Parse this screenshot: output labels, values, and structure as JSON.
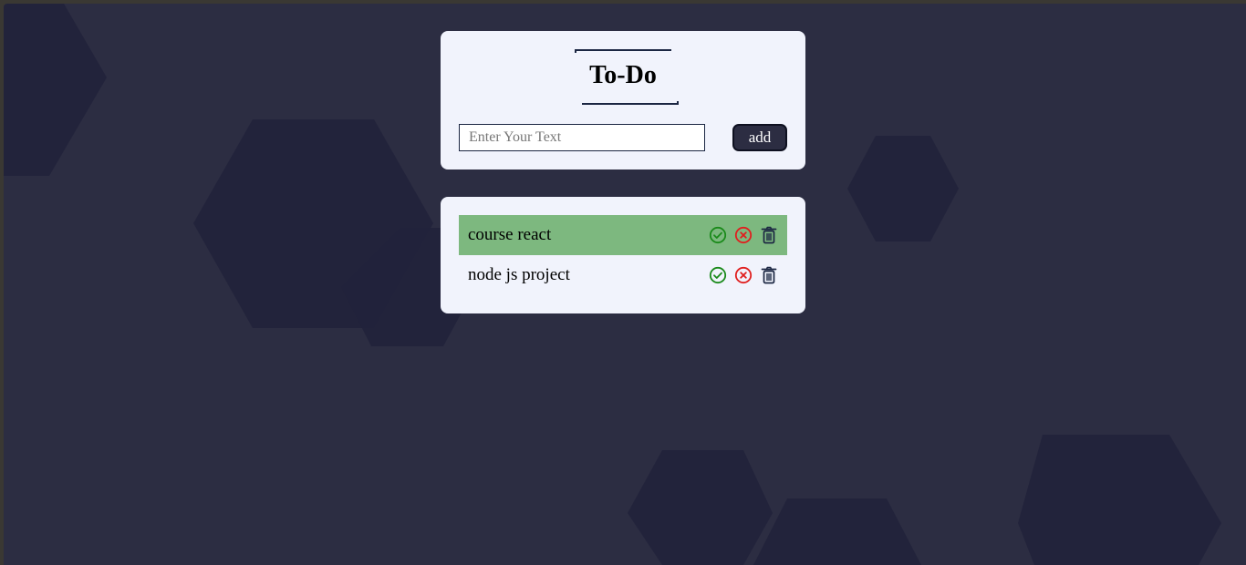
{
  "app": {
    "title": "To-Do"
  },
  "input": {
    "placeholder": "Enter Your Text",
    "value": "",
    "add_label": "add"
  },
  "tasks": [
    {
      "text": "course react",
      "completed": true
    },
    {
      "text": "node js project",
      "completed": false
    }
  ],
  "icons": {
    "complete": "check-circle-icon",
    "uncomplete": "x-circle-icon",
    "delete": "trash-icon"
  },
  "colors": {
    "background": "#2c2d42",
    "hexagon": "#22233b",
    "card": "#f1f3fc",
    "accent": "#1b2642",
    "completed_row": "#7db87f",
    "check": "#1a8a1a",
    "cross": "#e01f1f",
    "trash": "#1b2642"
  }
}
